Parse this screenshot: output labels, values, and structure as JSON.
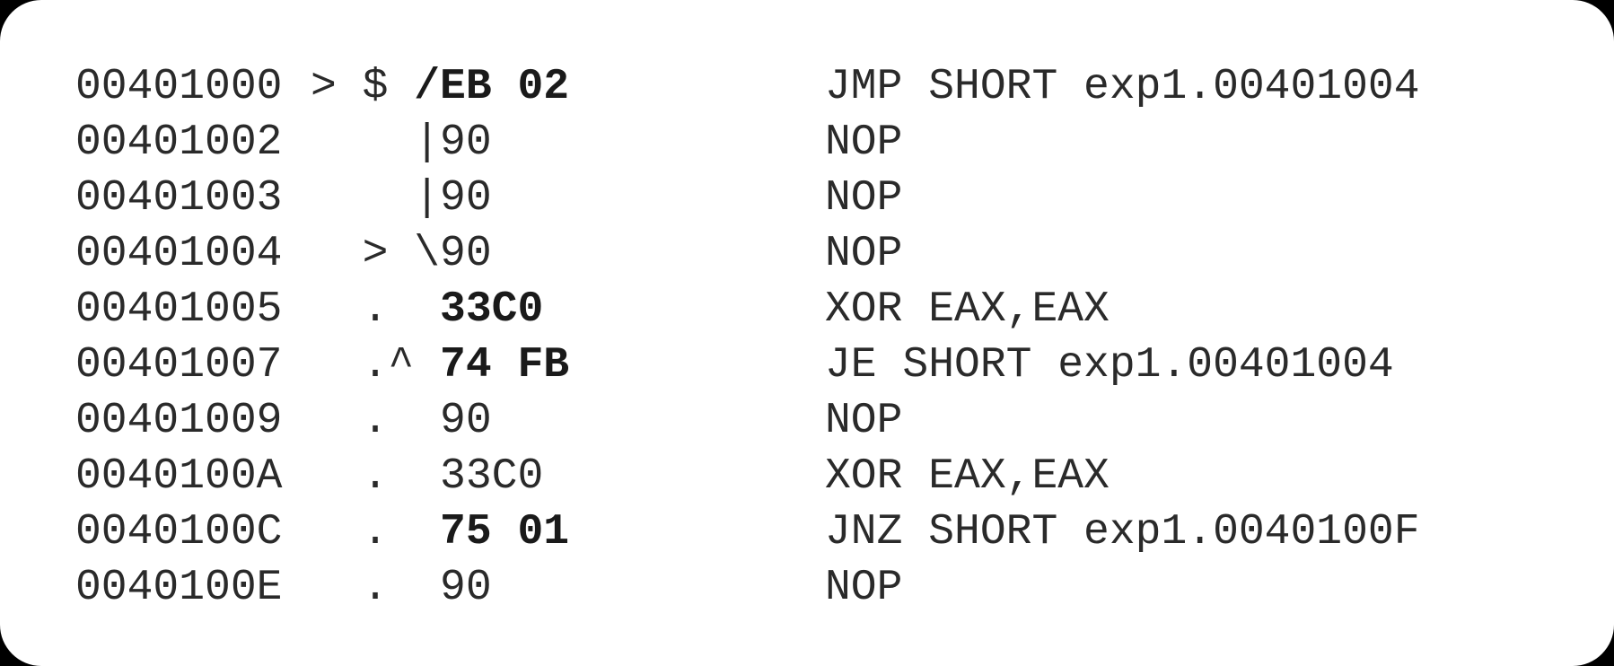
{
  "disassembly": {
    "rows": [
      {
        "address": "00401000",
        "marks": "> $ ",
        "bytes": "/EB 02",
        "bold": true,
        "instruction": "JMP SHORT exp1.00401004"
      },
      {
        "address": "00401002",
        "marks": "    ",
        "bytes": "|90",
        "bold": false,
        "instruction": "NOP"
      },
      {
        "address": "00401003",
        "marks": "    ",
        "bytes": "|90",
        "bold": false,
        "instruction": "NOP"
      },
      {
        "address": "00401004",
        "marks": "  > ",
        "bytes": "\\90",
        "bold": false,
        "instruction": "NOP"
      },
      {
        "address": "00401005",
        "marks": "  .  ",
        "bytes": "33C0",
        "bold": true,
        "instruction": "XOR EAX,EAX"
      },
      {
        "address": "00401007",
        "marks": "  .^ ",
        "bytes": "74 FB",
        "bold": true,
        "instruction": "JE SHORT exp1.00401004"
      },
      {
        "address": "00401009",
        "marks": "  .  ",
        "bytes": "90",
        "bold": false,
        "instruction": "NOP"
      },
      {
        "address": "0040100A",
        "marks": "  .  ",
        "bytes": "33C0",
        "bold": false,
        "instruction": "XOR EAX,EAX"
      },
      {
        "address": "0040100C",
        "marks": "  .  ",
        "bytes": "75 01",
        "bold": true,
        "instruction": "JNZ SHORT exp1.0040100F"
      },
      {
        "address": "0040100E",
        "marks": "  .  ",
        "bytes": "90",
        "bold": false,
        "instruction": "NOP"
      }
    ]
  }
}
